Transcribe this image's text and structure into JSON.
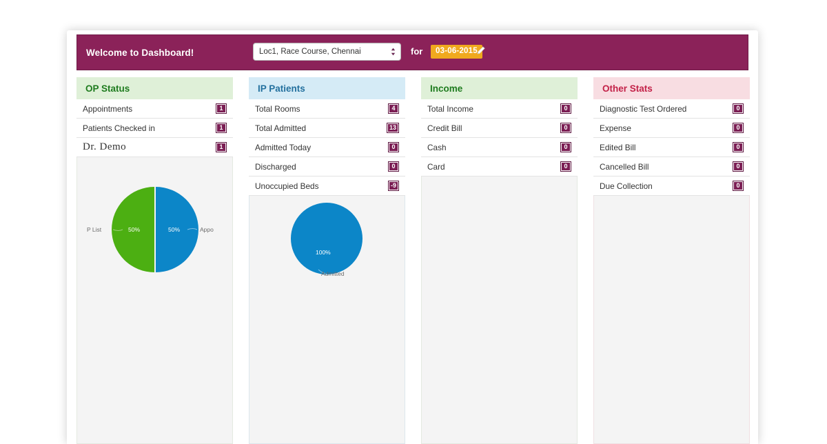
{
  "header": {
    "welcome_text": "Welcome to Dashboard!",
    "location_value": "Loc1, Race Course, Chennai",
    "for_label": "for",
    "date_value": "03-06-2015",
    "edit_icon": "pencil-icon",
    "select_icon": "updown-stepper-icon",
    "bar_color": "#8B2259",
    "date_badge_color": "#F0A91E"
  },
  "panels": [
    {
      "id": "op-status",
      "title": "OP Status",
      "accent": "#1E7B1E",
      "head_bg": "#DFF0D8",
      "rows": [
        {
          "label": "Appointments",
          "value": "1",
          "serif": false
        },
        {
          "label": "Patients Checked in",
          "value": "1",
          "serif": false
        },
        {
          "label": "Dr. Demo",
          "value": "1",
          "serif": true
        }
      ]
    },
    {
      "id": "ip-patients",
      "title": "IP Patients",
      "accent": "#23709E",
      "head_bg": "#D5EBF6",
      "rows": [
        {
          "label": "Total Rooms",
          "value": "4",
          "serif": false
        },
        {
          "label": "Total Admitted",
          "value": "13",
          "serif": false
        },
        {
          "label": "Admitted Today",
          "value": "0",
          "serif": false
        },
        {
          "label": "Discharged",
          "value": "0",
          "serif": false
        },
        {
          "label": "Unoccupied Beds",
          "value": "-9",
          "serif": false
        }
      ]
    },
    {
      "id": "income",
      "title": "Income",
      "accent": "#1E7B1E",
      "head_bg": "#DFF0D8",
      "rows": [
        {
          "label": "Total Income",
          "value": "0",
          "serif": false
        },
        {
          "label": "Credit Bill",
          "value": "0",
          "serif": false
        },
        {
          "label": "Cash",
          "value": "0",
          "serif": false
        },
        {
          "label": "Card",
          "value": "0",
          "serif": false
        }
      ]
    },
    {
      "id": "other-stats",
      "title": "Other Stats",
      "accent": "#C32148",
      "head_bg": "#F8DDE2",
      "rows": [
        {
          "label": "Diagnostic Test Ordered",
          "value": "0",
          "serif": false
        },
        {
          "label": "Expense",
          "value": "0",
          "serif": false
        },
        {
          "label": "Edited Bill",
          "value": "0",
          "serif": false
        },
        {
          "label": "Cancelled Bill",
          "value": "0",
          "serif": false
        },
        {
          "label": "Due Collection",
          "value": "0",
          "serif": false
        }
      ]
    }
  ],
  "chart_data": [
    {
      "type": "pie",
      "id": "op-status-pie",
      "title": "",
      "categories": [
        "P List",
        "Appo"
      ],
      "values": [
        50,
        50
      ],
      "value_labels": [
        "50%",
        "50%"
      ],
      "colors": [
        "#4CAF12",
        "#0C86C8"
      ],
      "legend_position": "outside-labels",
      "background": "#F4F4F4"
    },
    {
      "type": "pie",
      "id": "ip-patients-pie",
      "title": "",
      "categories": [
        "Admitted"
      ],
      "values": [
        100
      ],
      "value_labels": [
        "100%"
      ],
      "colors": [
        "#0C86C8"
      ],
      "legend_position": "outside-labels",
      "background": "#F4F4F4"
    }
  ]
}
